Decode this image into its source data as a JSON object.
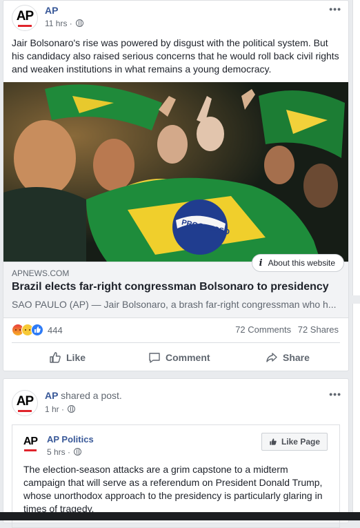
{
  "post1": {
    "page_name": "AP",
    "time": "11 hrs",
    "text": "Jair Bolsonaro's rise was powered by disgust with the political system. But his candidacy also raised serious concerns that he would roll back civil rights and weaken institutions in what remains a young democracy.",
    "link": {
      "domain": "APNEWS.COM",
      "title": "Brazil elects far-right congressman Bolsonaro to presidency",
      "description": "SAO PAULO (AP) — Jair Bolsonaro, a brash far-right congressman who h...",
      "about_label": "About this website"
    },
    "photo_banner_text": "PROGRESSO",
    "reaction_count": "444",
    "comments": "72 Comments",
    "shares": "72 Shares",
    "actions": {
      "like": "Like",
      "comment": "Comment",
      "share": "Share"
    }
  },
  "post2": {
    "page_name": "AP",
    "shared_text": "shared a post.",
    "time": "1 hr",
    "shared": {
      "page_name": "AP Politics",
      "time": "5 hrs",
      "like_page": "Like Page",
      "text": "The election-season attacks are a grim capstone to a midterm campaign that will serve as a referendum on President Donald Trump, whose unorthodox approach to the presidency is particularly glaring in times of tragedy."
    }
  },
  "logo_text": "AP",
  "more_glyph": "•••",
  "colors": {
    "link_blue": "#385898",
    "meta_gray": "#606770",
    "ap_red": "#e0242c"
  }
}
